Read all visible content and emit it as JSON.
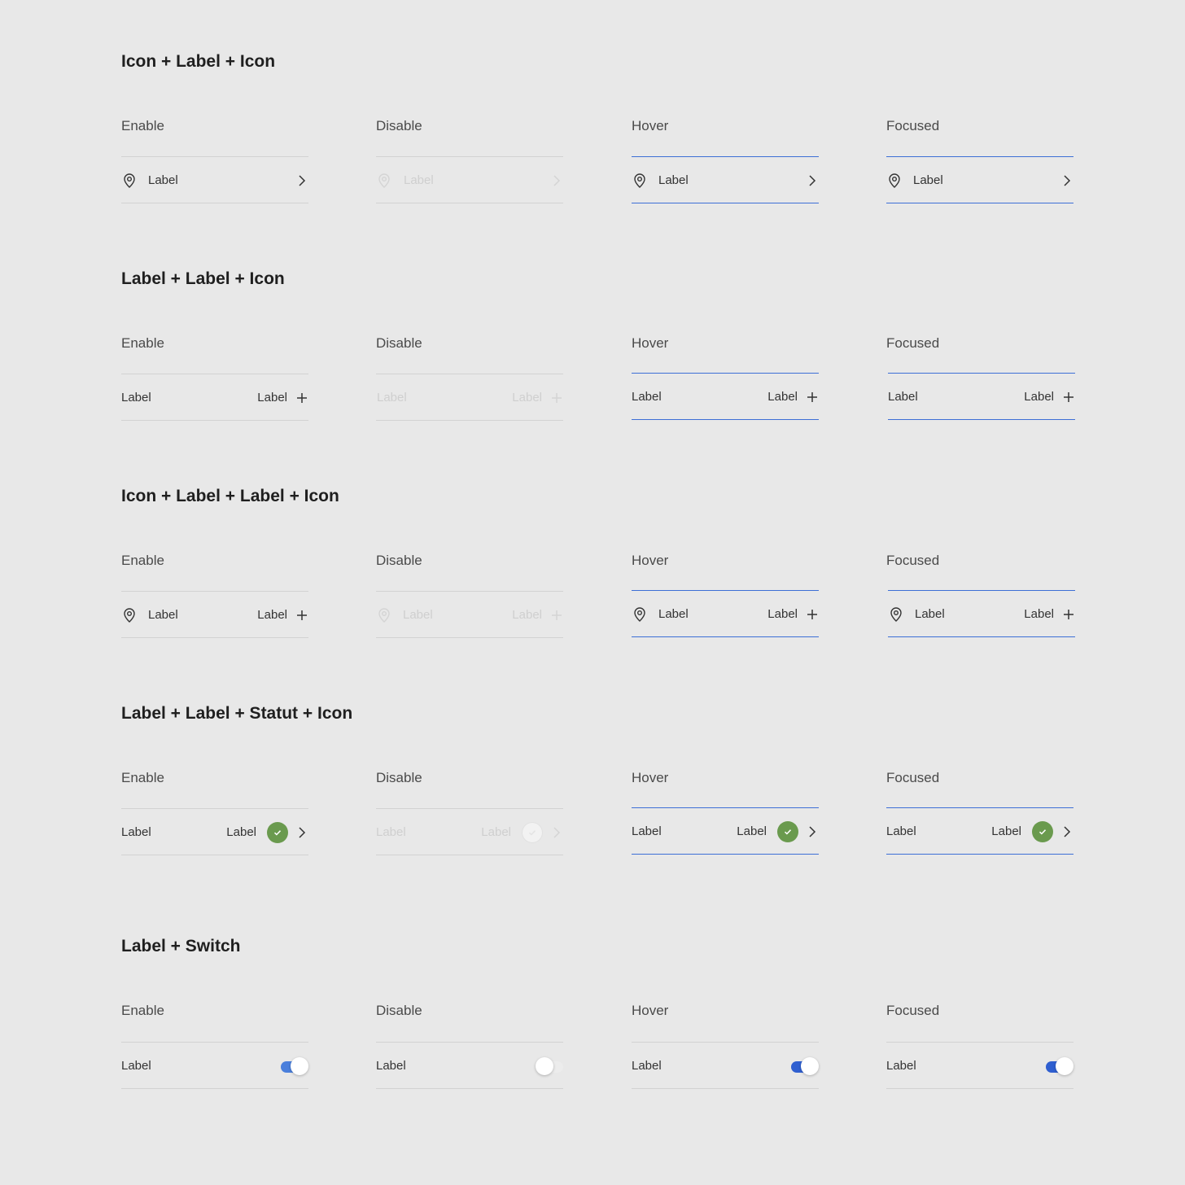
{
  "sections": [
    {
      "title": "Icon + Label + Icon"
    },
    {
      "title": "Label + Label + Icon"
    },
    {
      "title": "Icon + Label + Label + Icon"
    },
    {
      "title": "Label + Label + Statut + Icon"
    },
    {
      "title": "Label + Switch"
    }
  ],
  "states": [
    "Enable",
    "Disable",
    "Hover",
    "Focused"
  ],
  "item_label": "Label",
  "colors": {
    "background": "#e8e8e8",
    "accent_blue": "#3d6fd6",
    "status_green": "#6a9a4e",
    "divider": "#d2d2d2",
    "disabled_text": "#cfcfcf"
  },
  "switch_states": {
    "enable": true,
    "disable": false,
    "hover": true,
    "focused": true
  }
}
